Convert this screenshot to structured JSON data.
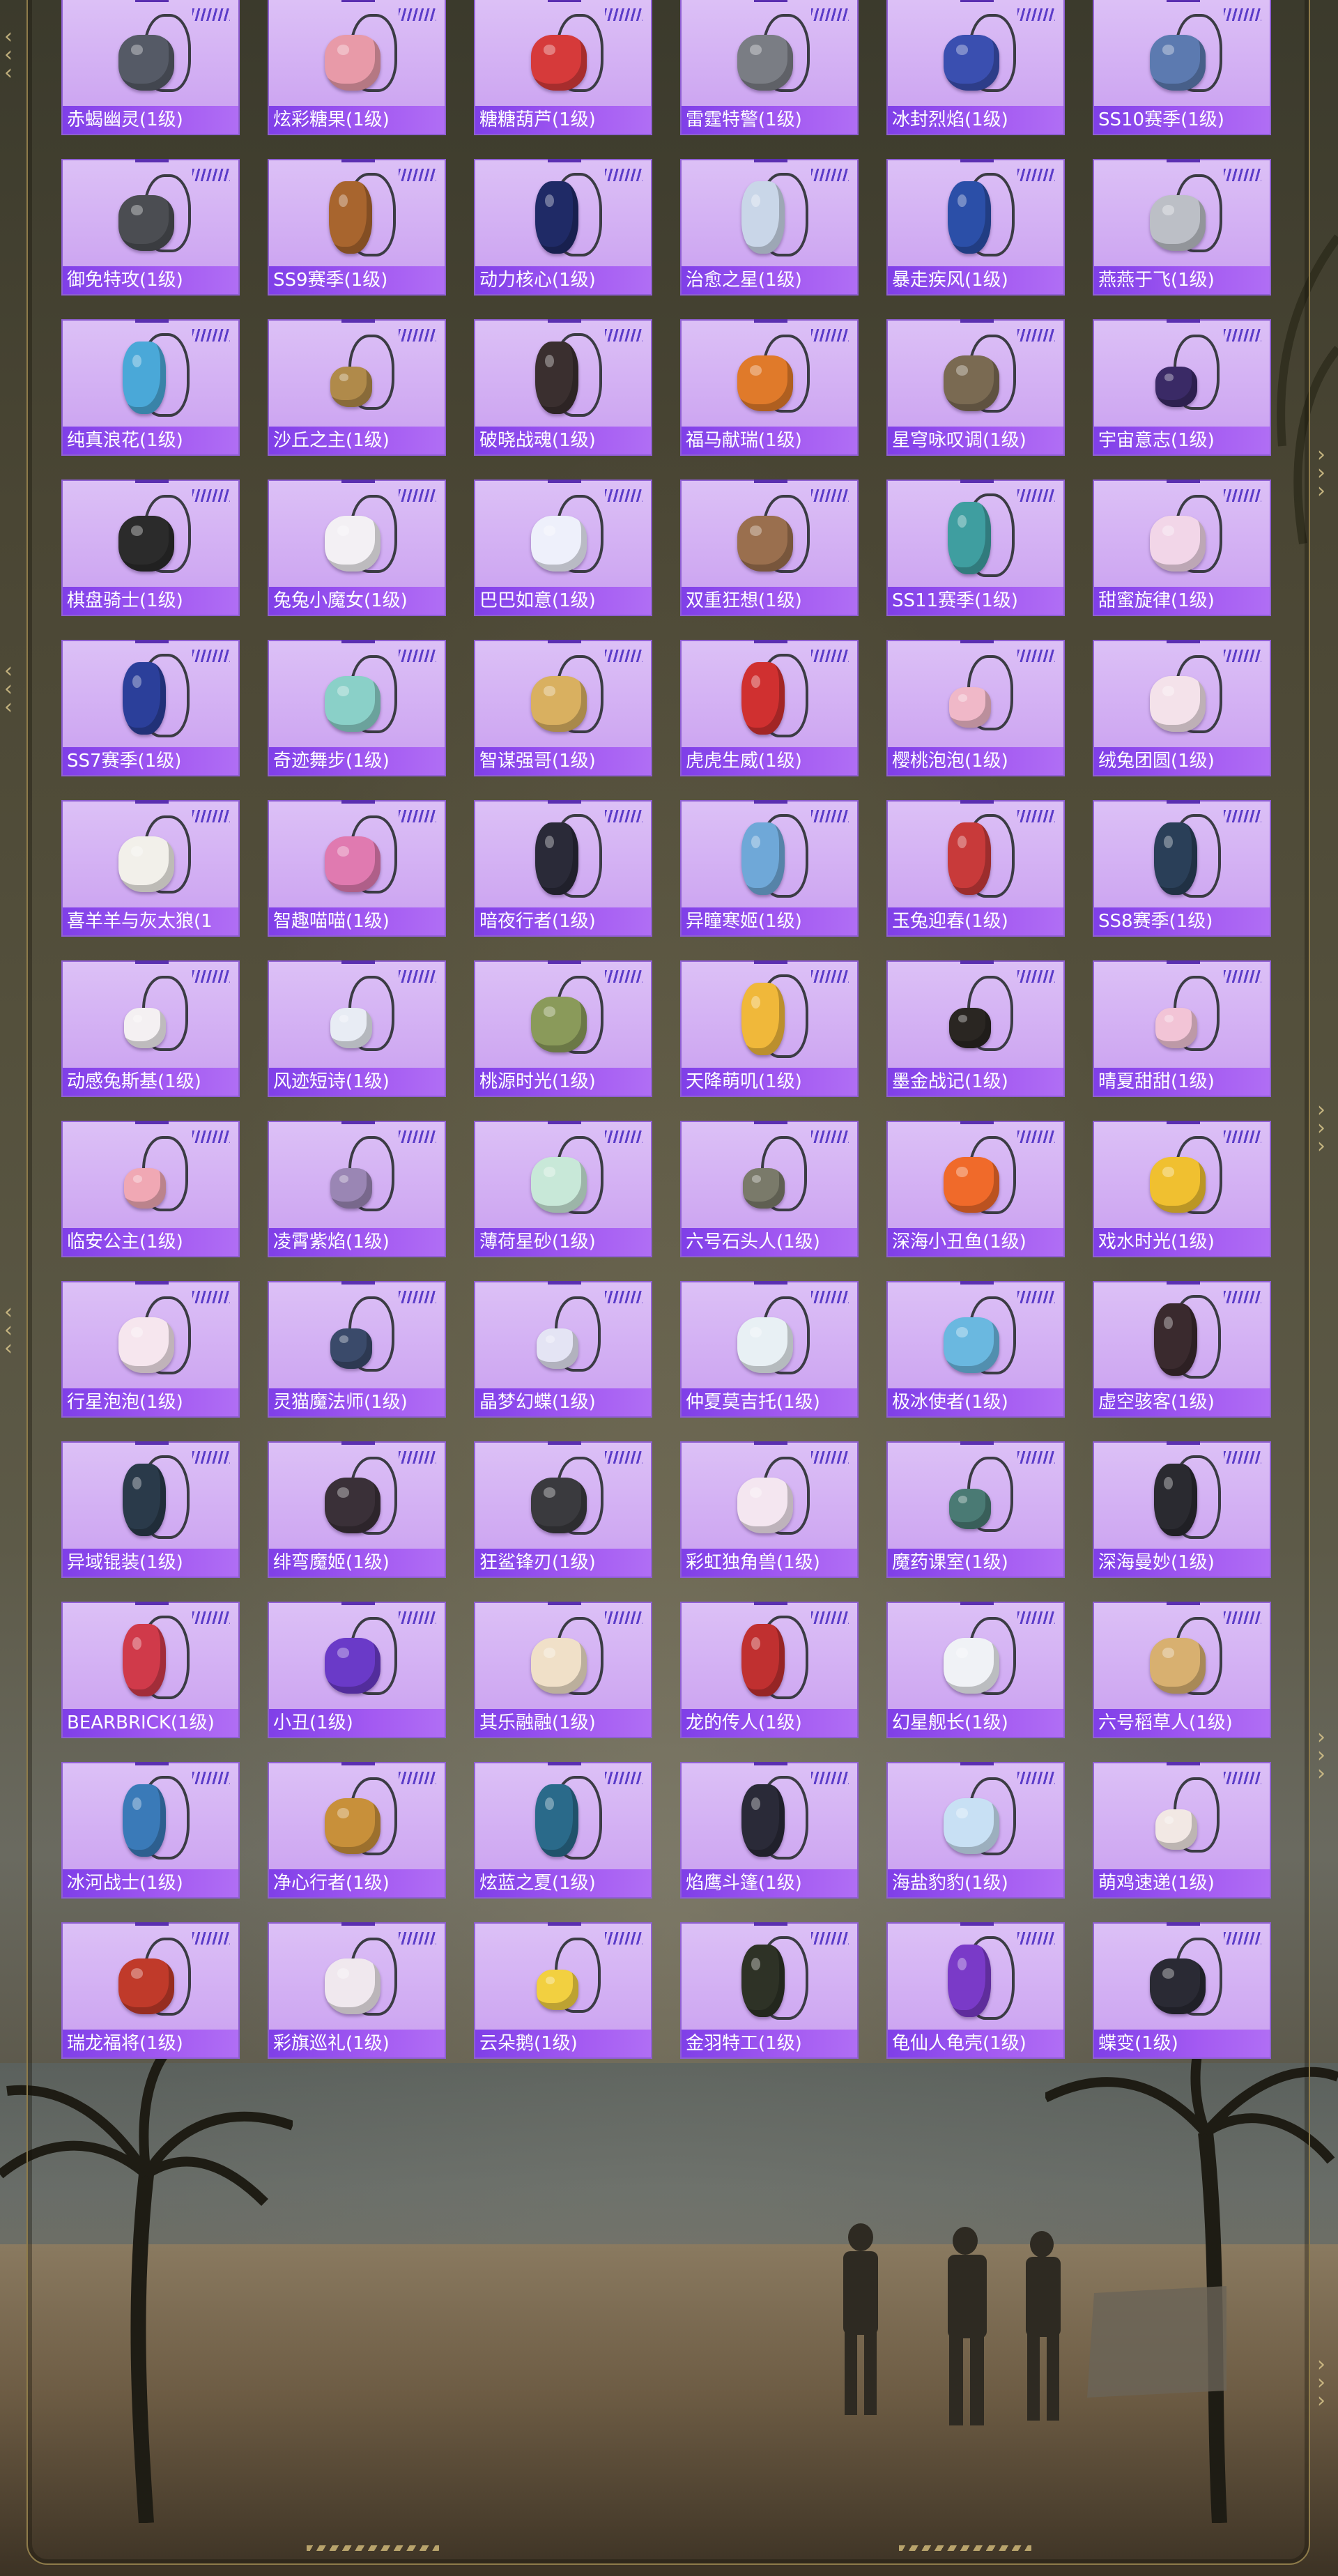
{
  "items": [
    {
      "label": "赤蝎幽灵(1级)",
      "icon": "scorpion-ghost-backpack-icon",
      "color": "#555a66",
      "style": "round"
    },
    {
      "label": "炫彩糖果(1级)",
      "icon": "candy-backpack-icon",
      "color": "#e89aa8",
      "style": "round"
    },
    {
      "label": "糖糖葫芦(1级)",
      "icon": "candied-haws-backpack-icon",
      "color": "#d63a3a",
      "style": "round"
    },
    {
      "label": "雷霆特警(1级)",
      "icon": "swat-backpack-icon",
      "color": "#7a7d84",
      "style": "round"
    },
    {
      "label": "冰封烈焰(1级)",
      "icon": "ice-flame-backpack-icon",
      "color": "#3a4fb0",
      "style": "round"
    },
    {
      "label": "SS10赛季(1级)",
      "icon": "ss10-backpack-icon",
      "color": "#5c7ab0",
      "style": "round"
    },
    {
      "label": "御免特攻(1级)",
      "icon": "assault-backpack-icon",
      "color": "#4b4d52",
      "style": "round"
    },
    {
      "label": "SS9赛季(1级)",
      "icon": "ss9-backpack-icon",
      "color": "#a8652e",
      "style": "tall"
    },
    {
      "label": "动力核心(1级)",
      "icon": "power-core-backpack-icon",
      "color": "#1f2a66",
      "style": "tall"
    },
    {
      "label": "治愈之星(1级)",
      "icon": "healing-star-backpack-icon",
      "color": "#c9d6e8",
      "style": "tall"
    },
    {
      "label": "暴走疾风(1级)",
      "icon": "gale-backpack-icon",
      "color": "#2b4fa8",
      "style": "tall"
    },
    {
      "label": "燕燕于飞(1级)",
      "icon": "swallow-backpack-icon",
      "color": "#bcbfc6",
      "style": "round"
    },
    {
      "label": "纯真浪花(1级)",
      "icon": "wave-backpack-icon",
      "color": "#4aa8d8",
      "style": "tall"
    },
    {
      "label": "沙丘之主(1级)",
      "icon": "dune-backpack-icon",
      "color": "#b08a4a",
      "style": "small"
    },
    {
      "label": "破晓战魂(1级)",
      "icon": "dawn-warrior-backpack-icon",
      "color": "#3a2f2f",
      "style": "tall"
    },
    {
      "label": "福马献瑞(1级)",
      "icon": "lucky-horse-backpack-icon",
      "color": "#e07a2a",
      "style": "round"
    },
    {
      "label": "星穹咏叹调(1级)",
      "icon": "star-aria-backpack-icon",
      "color": "#7a6a52",
      "style": "round"
    },
    {
      "label": "宇宙意志(1级)",
      "icon": "cosmic-will-backpack-icon",
      "color": "#3a2a66",
      "style": "small"
    },
    {
      "label": "棋盘骑士(1级)",
      "icon": "chess-knight-backpack-icon",
      "color": "#2b2b2b",
      "style": "round"
    },
    {
      "label": "兔兔小魔女(1级)",
      "icon": "bunny-witch-backpack-icon",
      "color": "#f3f0f4",
      "style": "round"
    },
    {
      "label": "巴巴如意(1级)",
      "icon": "baba-backpack-icon",
      "color": "#eef0fb",
      "style": "round"
    },
    {
      "label": "双重狂想(1级)",
      "icon": "dual-fantasy-backpack-icon",
      "color": "#9a6f4e",
      "style": "round"
    },
    {
      "label": "SS11赛季(1级)",
      "icon": "ss11-backpack-icon",
      "color": "#3f9ea0",
      "style": "tall"
    },
    {
      "label": "甜蜜旋律(1级)",
      "icon": "sweet-melody-backpack-icon",
      "color": "#f2d6e8",
      "style": "round"
    },
    {
      "label": "SS7赛季(1级)",
      "icon": "ss7-backpack-icon",
      "color": "#2b3f9a",
      "style": "tall"
    },
    {
      "label": "奇迹舞步(1级)",
      "icon": "miracle-dance-backpack-icon",
      "color": "#8ad0c8",
      "style": "round"
    },
    {
      "label": "智谋强哥(1级)",
      "icon": "smart-bro-backpack-icon",
      "color": "#d9b060",
      "style": "round"
    },
    {
      "label": "虎虎生威(1级)",
      "icon": "tiger-backpack-icon",
      "color": "#d03030",
      "style": "tall"
    },
    {
      "label": "樱桃泡泡(1级)",
      "icon": "cherry-bubble-backpack-icon",
      "color": "#f0b8c8",
      "style": "small"
    },
    {
      "label": "绒兔团圆(1级)",
      "icon": "plush-rabbit-backpack-icon",
      "color": "#f4e2ea",
      "style": "round"
    },
    {
      "label": "喜羊羊与灰太狼(1",
      "icon": "pleasant-goat-backpack-icon",
      "color": "#f2f0ea",
      "style": "round"
    },
    {
      "label": "智趣喵喵(1级)",
      "icon": "smart-cat-backpack-icon",
      "color": "#e07ab0",
      "style": "round"
    },
    {
      "label": "暗夜行者(1级)",
      "icon": "night-walker-backpack-icon",
      "color": "#2a2a38",
      "style": "tall"
    },
    {
      "label": "异瞳寒姬(1级)",
      "icon": "ice-princess-backpack-icon",
      "color": "#6fa8d8",
      "style": "tall"
    },
    {
      "label": "玉兔迎春(1级)",
      "icon": "jade-rabbit-backpack-icon",
      "color": "#c83a3a",
      "style": "tall"
    },
    {
      "label": "SS8赛季(1级)",
      "icon": "ss8-backpack-icon",
      "color": "#2a3f58",
      "style": "tall"
    },
    {
      "label": "动感兔斯基(1级)",
      "icon": "tuzki-backpack-icon",
      "color": "#f4f0f2",
      "style": "small"
    },
    {
      "label": "风迹短诗(1级)",
      "icon": "wind-poem-backpack-icon",
      "color": "#e8ecf4",
      "style": "small"
    },
    {
      "label": "桃源时光(1级)",
      "icon": "peach-garden-backpack-icon",
      "color": "#8a9a5a",
      "style": "round"
    },
    {
      "label": "天降萌叽(1级)",
      "icon": "cute-bird-backpack-icon",
      "color": "#f0b83a",
      "style": "tall"
    },
    {
      "label": "墨金战记(1级)",
      "icon": "ink-gold-backpack-icon",
      "color": "#2a2622",
      "style": "small"
    },
    {
      "label": "晴夏甜甜(1级)",
      "icon": "sunny-sweet-backpack-icon",
      "color": "#f2c4d6",
      "style": "small"
    },
    {
      "label": "临安公主(1级)",
      "icon": "princess-backpack-icon",
      "color": "#f0a8b4",
      "style": "small"
    },
    {
      "label": "凌霄紫焰(1级)",
      "icon": "purple-flame-backpack-icon",
      "color": "#9a86b4",
      "style": "small"
    },
    {
      "label": "薄荷星砂(1级)",
      "icon": "mint-star-backpack-icon",
      "color": "#c8e8d8",
      "style": "round"
    },
    {
      "label": "六号石头人(1级)",
      "icon": "stone-man-backpack-icon",
      "color": "#7a7a6a",
      "style": "small"
    },
    {
      "label": "深海小丑鱼(1级)",
      "icon": "clownfish-backpack-icon",
      "color": "#f06a2a",
      "style": "round"
    },
    {
      "label": "戏水时光(1级)",
      "icon": "water-play-backpack-icon",
      "color": "#f0c030",
      "style": "round"
    },
    {
      "label": "行星泡泡(1级)",
      "icon": "planet-bubble-backpack-icon",
      "color": "#f6e6ee",
      "style": "round"
    },
    {
      "label": "灵猫魔法师(1级)",
      "icon": "magic-cat-backpack-icon",
      "color": "#3a4a6a",
      "style": "small"
    },
    {
      "label": "晶梦幻蝶(1级)",
      "icon": "crystal-butterfly-backpack-icon",
      "color": "#e4e4f4",
      "style": "small"
    },
    {
      "label": "仲夏莫吉托(1级)",
      "icon": "mojito-backpack-icon",
      "color": "#e8f0f4",
      "style": "round"
    },
    {
      "label": "极冰使者(1级)",
      "icon": "ice-envoy-backpack-icon",
      "color": "#6ab8e0",
      "style": "round"
    },
    {
      "label": "虚空骇客(1级)",
      "icon": "void-hacker-backpack-icon",
      "color": "#3a2a2e",
      "style": "tall"
    },
    {
      "label": "异域锟装(1级)",
      "icon": "exotic-gear-backpack-icon",
      "color": "#2a3a4a",
      "style": "tall"
    },
    {
      "label": "绯弯魔姬(1级)",
      "icon": "scarlet-witch-backpack-icon",
      "color": "#3a3038",
      "style": "round"
    },
    {
      "label": "狂鲨锋刃(1级)",
      "icon": "shark-blade-backpack-icon",
      "color": "#3a3a3e",
      "style": "round"
    },
    {
      "label": "彩虹独角兽(1级)",
      "icon": "unicorn-backpack-icon",
      "color": "#f4e6f0",
      "style": "round"
    },
    {
      "label": "魔药课室(1级)",
      "icon": "potion-class-backpack-icon",
      "color": "#4a7a74",
      "style": "small"
    },
    {
      "label": "深海曼妙(1级)",
      "icon": "deep-sea-backpack-icon",
      "color": "#2a2a30",
      "style": "tall"
    },
    {
      "label": "BEARBRICK(1级)",
      "icon": "bearbrick-backpack-icon",
      "color": "#d03a4a",
      "style": "tall"
    },
    {
      "label": "小丑(1级)",
      "icon": "clown-backpack-icon",
      "color": "#6a3ac8",
      "style": "round"
    },
    {
      "label": "其乐融融(1级)",
      "icon": "joyful-backpack-icon",
      "color": "#f0e0c8",
      "style": "round"
    },
    {
      "label": "龙的传人(1级)",
      "icon": "dragon-heir-backpack-icon",
      "color": "#c03030",
      "style": "tall"
    },
    {
      "label": "幻星舰长(1级)",
      "icon": "star-captain-backpack-icon",
      "color": "#f0f2f6",
      "style": "round"
    },
    {
      "label": "六号稻草人(1级)",
      "icon": "scarecrow-backpack-icon",
      "color": "#d8b070",
      "style": "round"
    },
    {
      "label": "冰河战士(1级)",
      "icon": "glacier-warrior-backpack-icon",
      "color": "#3a7ab8",
      "style": "tall"
    },
    {
      "label": "净心行者(1级)",
      "icon": "gourd-backpack-icon",
      "color": "#c8903a",
      "style": "round"
    },
    {
      "label": "炫蓝之夏(1级)",
      "icon": "blue-summer-backpack-icon",
      "color": "#2a6a8a",
      "style": "tall"
    },
    {
      "label": "焰鹰斗篷(1级)",
      "icon": "flame-eagle-backpack-icon",
      "color": "#2a2a38",
      "style": "tall"
    },
    {
      "label": "海盐豹豹(1级)",
      "icon": "sea-salt-leopard-backpack-icon",
      "color": "#c8e0f4",
      "style": "round"
    },
    {
      "label": "萌鸡速递(1级)",
      "icon": "chick-delivery-backpack-icon",
      "color": "#f2e8e4",
      "style": "small"
    },
    {
      "label": "瑞龙福将(1级)",
      "icon": "lucky-dragon-backpack-icon",
      "color": "#c03a2a",
      "style": "round"
    },
    {
      "label": "彩旗巡礼(1级)",
      "icon": "flag-parade-backpack-icon",
      "color": "#f0e8ee",
      "style": "round"
    },
    {
      "label": "云朵鹅(1级)",
      "icon": "cloud-goose-backpack-icon",
      "color": "#f2d040",
      "style": "small"
    },
    {
      "label": "金羽特工(1级)",
      "icon": "golden-feather-backpack-icon",
      "color": "#2e3226",
      "style": "tall"
    },
    {
      "label": "龟仙人龟壳(1级)",
      "icon": "turtle-shell-backpack-icon",
      "color": "#7a3ac8",
      "style": "tall"
    },
    {
      "label": "蝶变(1级)",
      "icon": "butterfly-change-backpack-icon",
      "color": "#2a2a34",
      "style": "round"
    }
  ]
}
